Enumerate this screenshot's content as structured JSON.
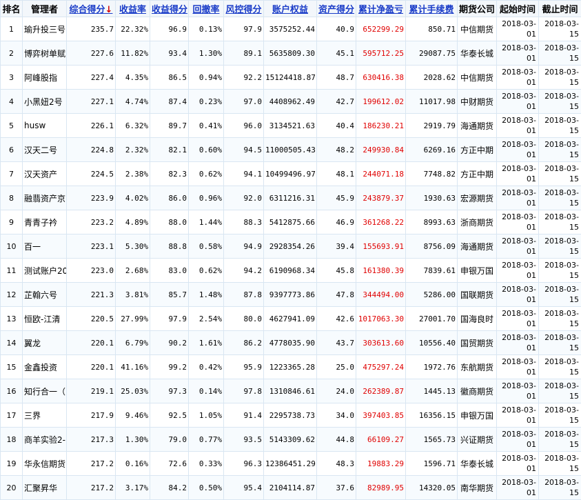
{
  "colors": {
    "header_link": "#1a3cc8",
    "sort_arrow": "#d40000",
    "profit_red": "#e00000",
    "border": "#d9e6f2"
  },
  "sort_arrow": "↓",
  "headers": [
    "排名",
    "管理者",
    "综合得分",
    "收益率",
    "收益得分",
    "回撤率",
    "风控得分",
    "账户权益",
    "资产得分",
    "累计净盈亏",
    "累计手续费",
    "期货公司",
    "起始时间",
    "截止时间"
  ],
  "rows": [
    {
      "rank": "1",
      "manager": "瑜升投三号",
      "score": "235.7",
      "return": "22.32%",
      "return_score": "96.9",
      "drawdown": "0.13%",
      "risk_score": "97.9",
      "equity": "3575252.44",
      "asset_score": "40.9",
      "pnl": "652299.29",
      "fee": "850.71",
      "company": "中信期货",
      "start": "2018-03-01",
      "end": "2018-03-15"
    },
    {
      "rank": "2",
      "manager": "博弈树单赋",
      "score": "227.6",
      "return": "11.82%",
      "return_score": "93.4",
      "drawdown": "1.30%",
      "risk_score": "89.1",
      "equity": "5635809.30",
      "asset_score": "45.1",
      "pnl": "595712.25",
      "fee": "29087.75",
      "company": "华泰长城",
      "start": "2018-03-01",
      "end": "2018-03-15"
    },
    {
      "rank": "3",
      "manager": "阿峰股指",
      "score": "227.4",
      "return": "4.35%",
      "return_score": "86.5",
      "drawdown": "0.94%",
      "risk_score": "92.2",
      "equity": "15124418.87",
      "asset_score": "48.7",
      "pnl": "630416.38",
      "fee": "2028.62",
      "company": "中信期货",
      "start": "2018-03-01",
      "end": "2018-03-15"
    },
    {
      "rank": "4",
      "manager": "小黑妞2号",
      "score": "227.1",
      "return": "4.74%",
      "return_score": "87.4",
      "drawdown": "0.23%",
      "risk_score": "97.0",
      "equity": "4408962.49",
      "asset_score": "42.7",
      "pnl": "199612.02",
      "fee": "11017.98",
      "company": "中财期货",
      "start": "2018-03-01",
      "end": "2018-03-15"
    },
    {
      "rank": "5",
      "manager": "husw",
      "score": "226.1",
      "return": "6.32%",
      "return_score": "89.7",
      "drawdown": "0.41%",
      "risk_score": "96.0",
      "equity": "3134521.63",
      "asset_score": "40.4",
      "pnl": "186230.21",
      "fee": "2919.79",
      "company": "海通期货",
      "start": "2018-03-01",
      "end": "2018-03-15"
    },
    {
      "rank": "6",
      "manager": "汉天二号",
      "score": "224.8",
      "return": "2.32%",
      "return_score": "82.1",
      "drawdown": "0.60%",
      "risk_score": "94.5",
      "equity": "11000505.43",
      "asset_score": "48.2",
      "pnl": "249930.84",
      "fee": "6269.16",
      "company": "方正中期",
      "start": "2018-03-01",
      "end": "2018-03-15"
    },
    {
      "rank": "7",
      "manager": "汉天资产",
      "score": "224.5",
      "return": "2.38%",
      "return_score": "82.3",
      "drawdown": "0.62%",
      "risk_score": "94.1",
      "equity": "10499496.97",
      "asset_score": "48.1",
      "pnl": "244071.18",
      "fee": "7748.82",
      "company": "方正中期",
      "start": "2018-03-01",
      "end": "2018-03-15"
    },
    {
      "rank": "8",
      "manager": "融翡资产京",
      "score": "223.9",
      "return": "4.02%",
      "return_score": "86.0",
      "drawdown": "0.96%",
      "risk_score": "92.0",
      "equity": "6311216.31",
      "asset_score": "45.9",
      "pnl": "243879.37",
      "fee": "1930.63",
      "company": "宏源期货",
      "start": "2018-03-01",
      "end": "2018-03-15"
    },
    {
      "rank": "9",
      "manager": "青青子衿",
      "score": "223.2",
      "return": "4.89%",
      "return_score": "88.0",
      "drawdown": "1.44%",
      "risk_score": "88.3",
      "equity": "5412875.66",
      "asset_score": "46.9",
      "pnl": "361268.22",
      "fee": "8993.63",
      "company": "浙商期货",
      "start": "2018-03-01",
      "end": "2018-03-15"
    },
    {
      "rank": "10",
      "manager": "百一",
      "score": "223.1",
      "return": "5.30%",
      "return_score": "88.8",
      "drawdown": "0.58%",
      "risk_score": "94.9",
      "equity": "2928354.26",
      "asset_score": "39.4",
      "pnl": "155693.91",
      "fee": "8756.09",
      "company": "海通期货",
      "start": "2018-03-01",
      "end": "2018-03-15"
    },
    {
      "rank": "11",
      "manager": "测试账户20",
      "score": "223.0",
      "return": "2.68%",
      "return_score": "83.0",
      "drawdown": "0.62%",
      "risk_score": "94.2",
      "equity": "6190968.34",
      "asset_score": "45.8",
      "pnl": "161380.39",
      "fee": "7839.61",
      "company": "申银万国",
      "start": "2018-03-01",
      "end": "2018-03-15"
    },
    {
      "rank": "12",
      "manager": "芷翰六号",
      "score": "221.3",
      "return": "3.81%",
      "return_score": "85.7",
      "drawdown": "1.48%",
      "risk_score": "87.8",
      "equity": "9397773.86",
      "asset_score": "47.8",
      "pnl": "344494.00",
      "fee": "5286.00",
      "company": "国联期货",
      "start": "2018-03-01",
      "end": "2018-03-15"
    },
    {
      "rank": "13",
      "manager": "恒欧-江清",
      "score": "220.5",
      "return": "27.99%",
      "return_score": "97.9",
      "drawdown": "2.54%",
      "risk_score": "80.0",
      "equity": "4627941.09",
      "asset_score": "42.6",
      "pnl": "1017063.30",
      "fee": "27001.70",
      "company": "国海良时",
      "start": "2018-03-01",
      "end": "2018-03-15"
    },
    {
      "rank": "14",
      "manager": "翼龙",
      "score": "220.1",
      "return": "6.79%",
      "return_score": "90.2",
      "drawdown": "1.61%",
      "risk_score": "86.2",
      "equity": "4778035.90",
      "asset_score": "43.7",
      "pnl": "303613.60",
      "fee": "10556.40",
      "company": "国贸期货",
      "start": "2018-03-01",
      "end": "2018-03-15"
    },
    {
      "rank": "15",
      "manager": "金鑫投资",
      "score": "220.1",
      "return": "41.16%",
      "return_score": "99.2",
      "drawdown": "0.42%",
      "risk_score": "95.9",
      "equity": "1223365.28",
      "asset_score": "25.0",
      "pnl": "475297.24",
      "fee": "1972.76",
      "company": "东航期货",
      "start": "2018-03-01",
      "end": "2018-03-15"
    },
    {
      "rank": "16",
      "manager": "知行合一（",
      "score": "219.1",
      "return": "25.03%",
      "return_score": "97.3",
      "drawdown": "0.14%",
      "risk_score": "97.8",
      "equity": "1310846.61",
      "asset_score": "24.0",
      "pnl": "262389.87",
      "fee": "1445.13",
      "company": "徽商期货",
      "start": "2018-03-01",
      "end": "2018-03-15"
    },
    {
      "rank": "17",
      "manager": "三界",
      "score": "217.9",
      "return": "9.46%",
      "return_score": "92.5",
      "drawdown": "1.05%",
      "risk_score": "91.4",
      "equity": "2295738.73",
      "asset_score": "34.0",
      "pnl": "397403.85",
      "fee": "16356.15",
      "company": "申银万国",
      "start": "2018-03-01",
      "end": "2018-03-15"
    },
    {
      "rank": "18",
      "manager": "商羊实验2-",
      "score": "217.3",
      "return": "1.30%",
      "return_score": "79.0",
      "drawdown": "0.77%",
      "risk_score": "93.5",
      "equity": "5143309.62",
      "asset_score": "44.8",
      "pnl": "66109.27",
      "fee": "1565.73",
      "company": "兴证期货",
      "start": "2018-03-01",
      "end": "2018-03-15"
    },
    {
      "rank": "19",
      "manager": "华永信期货",
      "score": "217.2",
      "return": "0.16%",
      "return_score": "72.6",
      "drawdown": "0.33%",
      "risk_score": "96.3",
      "equity": "12386451.29",
      "asset_score": "48.3",
      "pnl": "19883.29",
      "fee": "1596.71",
      "company": "华泰长城",
      "start": "2018-03-01",
      "end": "2018-03-15"
    },
    {
      "rank": "20",
      "manager": "汇聚昇华",
      "score": "217.2",
      "return": "3.17%",
      "return_score": "84.2",
      "drawdown": "0.50%",
      "risk_score": "95.4",
      "equity": "2104114.87",
      "asset_score": "37.6",
      "pnl": "82989.95",
      "fee": "14320.05",
      "company": "南华期货",
      "start": "2018-03-01",
      "end": "2018-03-15"
    }
  ]
}
